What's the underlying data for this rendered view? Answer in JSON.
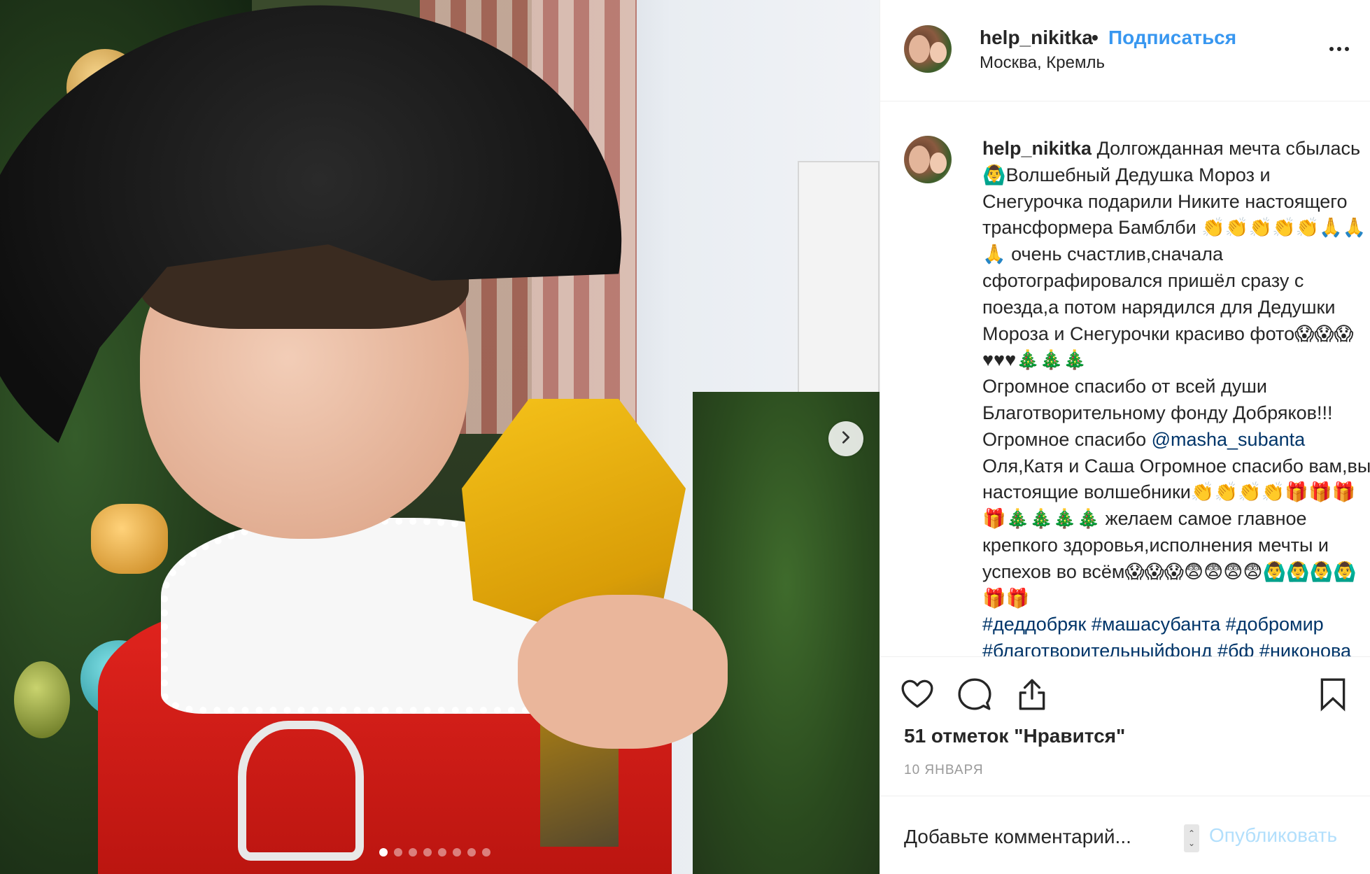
{
  "post": {
    "carousel": {
      "slide_count": 8,
      "active_index": 0,
      "next_icon": "chevron-right-icon"
    },
    "header": {
      "username": "help_nikitka",
      "separator": "•",
      "follow_label": "Подписаться",
      "location": "Москва, Кремль",
      "more_icon": "more-horizontal-icon"
    },
    "caption": {
      "username": "help_nikitka",
      "text_1": " Долгожданная мечта сбылась🙆‍♂️Волшебный Дедушка Мороз и Снегурочка подарили Никите настоящего трансформера Бамблби 👏👏👏👏👏🙏🙏🙏 очень счастлив,сначала сфотографировался пришёл сразу с поезда,а потом нарядился для Дедушки Мороза и Снегурочки красиво фото😱😱😱♥♥♥🎄🎄🎄\nОгромное спасибо от всей души Благотворительному фонду Добряков!!! Огромное спасибо ",
      "mention": "@masha_subanta",
      "text_2": " Оля,Катя и Саша Огромное спасибо вам,вы настоящие волшебники👏👏👏👏🎁🎁🎁🎁🎄🎄🎄🎄 желаем самое главное крепкого здоровья,исполнения мечты и успехов во всём😱😱😱😨😨😨😨🙆‍♂️🙆‍♂️🙆‍♂️🙆‍♂️🎁🎁\n",
      "hashtags": "#деддобряк #машасубанта #добромир #благотворительныйфонд #бф #никонова #новыйгод #подарок #заветнаямечта #трансформер #счастье #радость #спасибо"
    },
    "actions": {
      "like_icon": "heart-icon",
      "comment_icon": "comment-icon",
      "share_icon": "share-icon",
      "save_icon": "bookmark-icon"
    },
    "likes": "51 отметок \"Нравится\"",
    "date": "10 ЯНВАРЯ",
    "comment": {
      "placeholder": "Добавьте комментарий...",
      "publish_label": "Опубликовать"
    }
  },
  "colors": {
    "link": "#3897f0",
    "publish_disabled": "#b2dffc",
    "text": "#262626",
    "muted": "#999999",
    "divider": "#efefef"
  }
}
